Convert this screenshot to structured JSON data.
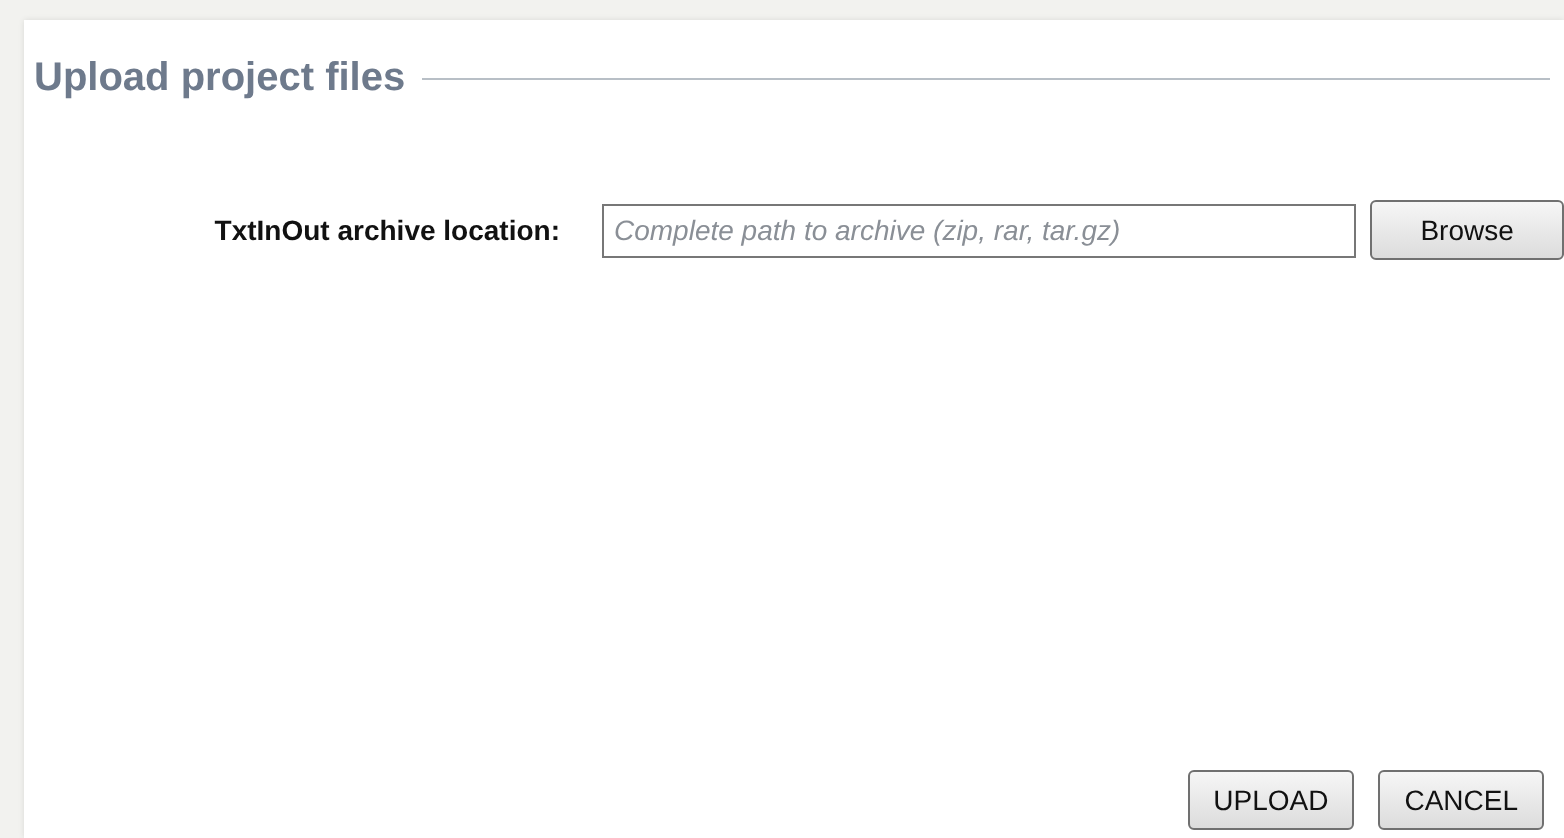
{
  "title": "Upload project files",
  "field": {
    "label": "TxtInOut archive location:",
    "placeholder": "Complete path to archive (zip, rar, tar.gz)"
  },
  "browse_button": "Browse",
  "buttons": [
    "UPLOAD",
    "CANCEL"
  ]
}
